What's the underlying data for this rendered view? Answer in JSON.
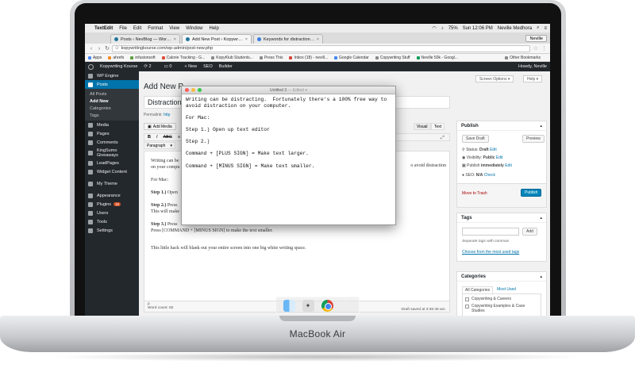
{
  "device": {
    "brand": "MacBook Air"
  },
  "menubar": {
    "app": "TextEdit",
    "items": [
      "File",
      "Edit",
      "Format",
      "View",
      "Window",
      "Help"
    ],
    "status": {
      "battery": "75%",
      "datetime": "Sun 12:06 PM",
      "user": "Neville Medhora"
    }
  },
  "browser": {
    "tabs": [
      {
        "title": "Posts ‹ NevBlog — WordPress"
      },
      {
        "title": "Add New Post ‹ Kopywriting K"
      },
      {
        "title": "Keywords for distraction free w"
      }
    ],
    "user_chip": "Neville",
    "url": "kopywritingkourse.com/wp-admin/post-new.php",
    "bookmarks": [
      "Apps",
      "ahrefs",
      "infusionsoft",
      "Calorie Tracking - G...",
      "KopyKlub Students...",
      "Press This",
      "Inbox (18) - nevill...",
      "Google Calendar",
      "Copywriting Stuff",
      "Neville 50k - Googl..."
    ],
    "other_bookmarks": "Other Bookmarks"
  },
  "wp_adminbar": {
    "site": "Kopywriting Kourse",
    "updates": "2",
    "comments": "0",
    "new": "+ New",
    "seo": "SEO",
    "builder": "Builder",
    "howdy": "Howdy, Neville"
  },
  "wp_sidebar": {
    "top": [
      {
        "label": "WP Engine"
      }
    ],
    "posts": {
      "label": "Posts",
      "sub": [
        "All Posts",
        "Add New",
        "Categories",
        "Tags"
      ],
      "current": "Add New"
    },
    "items": [
      {
        "label": "Media"
      },
      {
        "label": "Pages"
      },
      {
        "label": "Comments"
      },
      {
        "label": "KingSumo Giveaways"
      },
      {
        "label": "LeadPages"
      },
      {
        "label": "Widget Content"
      },
      {
        "label": "My Theme"
      },
      {
        "label": "Appearance"
      },
      {
        "label": "Plugins",
        "badge": "16"
      },
      {
        "label": "Users"
      },
      {
        "label": "Tools"
      },
      {
        "label": "Settings"
      }
    ]
  },
  "editor": {
    "page_title": "Add New P",
    "screen_options": "Screen Options ▾",
    "help": "Help ▾",
    "post_title": "Distraction",
    "permalink_label": "Permalink:",
    "permalink_url": "http",
    "add_media": "Add Media",
    "tab_visual": "Visual",
    "tab_text": "Text",
    "format_buttons": [
      "B",
      "I",
      "ABC",
      "≡"
    ],
    "paragraph": "Paragraph",
    "content": {
      "p1_start": "Writing can be",
      "p1_line2": "on your compu",
      "p1_end": "o avoid distraction",
      "for_mac": "For Mac:",
      "step1_label": "Step 1.)",
      "step1_text": "Open",
      "step2_label": "Step 2.)",
      "step2_text": "Press",
      "step2_line2": "This will make",
      "step3_label": "Step 3.)",
      "step3_text": "Press",
      "step3_line2": "Press [COMMAND + [MINUS SIGN] to make the text smaller.",
      "hack": "This little hack will blank out your entire screen into one big white writing space."
    },
    "path": "p",
    "word_count": "Word count: 82",
    "draft_saved": "Draft saved at 3:36:49 am."
  },
  "publish_box": {
    "title": "Publish",
    "save_draft": "Save Draft",
    "preview": "Preview",
    "status_label": "Status:",
    "status_value": "Draft",
    "status_edit": "Edit",
    "visibility_label": "Visibility:",
    "visibility_value": "Public",
    "visibility_edit": "Edit",
    "publish_label": "Publish",
    "publish_value": "immediately",
    "publish_edit": "Edit",
    "seo_label": "SEO:",
    "seo_value": "N/A",
    "seo_check": "Check",
    "trash": "Move to Trash",
    "publish_btn": "Publish"
  },
  "tags_box": {
    "title": "Tags",
    "add": "Add",
    "hint": "Separate tags with commas",
    "choose": "Choose from the most used tags"
  },
  "categories_box": {
    "title": "Categories",
    "tab_all": "All Categories",
    "tab_most": "Most Used",
    "items": [
      "Copywriting & Careers",
      "Copywriting Examples & Case Studies"
    ]
  },
  "textedit": {
    "title": "Untitled 3",
    "edited": "— Edited ▾",
    "lines": [
      "Writing can be distracting.  Fortunately there's a 100% free way to",
      "avoid distraction on your computer.",
      "",
      "For Mac:",
      "",
      "Step 1.) Open up text editor",
      "",
      "Step 2.)",
      "",
      "Command + [PLUS SIGN] = Make text larger.",
      "",
      "Command + [MINUS SIGN] = Make text smaller."
    ]
  },
  "dock": {
    "apps": [
      "finder-icon",
      "launchpad-icon",
      "chrome-icon",
      "trash-icon"
    ]
  }
}
